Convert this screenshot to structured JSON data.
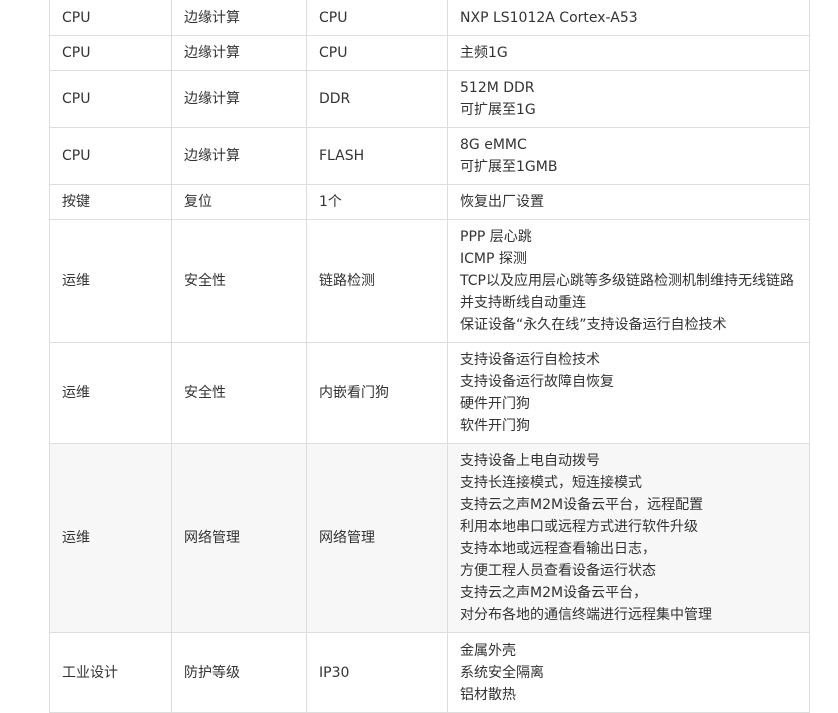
{
  "rows": [
    {
      "c1": "CPU",
      "c2": "边缘计算",
      "c3": "CPU",
      "c4": [
        "NXP LS1012A Cortex-A53"
      ]
    },
    {
      "c1": "CPU",
      "c2": "边缘计算",
      "c3": "CPU",
      "c4": [
        "主频1G"
      ]
    },
    {
      "c1": "CPU",
      "c2": "边缘计算",
      "c3": "DDR",
      "c4": [
        "512M DDR",
        "可扩展至1G"
      ]
    },
    {
      "c1": "CPU",
      "c2": "边缘计算",
      "c3": "FLASH",
      "c4": [
        "8G eMMC",
        "可扩展至1GMB"
      ]
    },
    {
      "c1": "按键",
      "c2": "复位",
      "c3": "1个",
      "c4": [
        "恢复出厂设置"
      ]
    },
    {
      "c1": "运维",
      "c2": "安全性",
      "c3": "链路检测",
      "c4": [
        "PPP 层心跳",
        "ICMP 探测",
        "TCP以及应用层心跳等多级链路检测机制维持无线链路",
        "并支持断线自动重连",
        "保证设备“永久在线”支持设备运行自检技术"
      ]
    },
    {
      "c1": "运维",
      "c2": "安全性",
      "c3": "内嵌看门狗",
      "c4": [
        "支持设备运行自检技术",
        "支持设备运行故障自恢复",
        "硬件开门狗",
        "软件开门狗"
      ]
    },
    {
      "c1": "运维",
      "c2": "网络管理",
      "c3": "网络管理",
      "c4": [
        "支持设备上电自动拨号",
        "支持长连接模式，短连接模式",
        "支持云之声M2M设备云平台，远程配置",
        "利用本地串口或远程方式进行软件升级",
        "支持本地或远程查看输出日志，",
        "方便工程人员查看设备运行状态",
        "支持云之声M2M设备云平台，",
        "对分布各地的通信终端进行远程集中管理"
      ]
    },
    {
      "c1": "工业设计",
      "c2": "防护等级",
      "c3": "IP30",
      "c4": [
        "金属外壳",
        "系统安全隔离",
        "铝材散热"
      ]
    }
  ]
}
